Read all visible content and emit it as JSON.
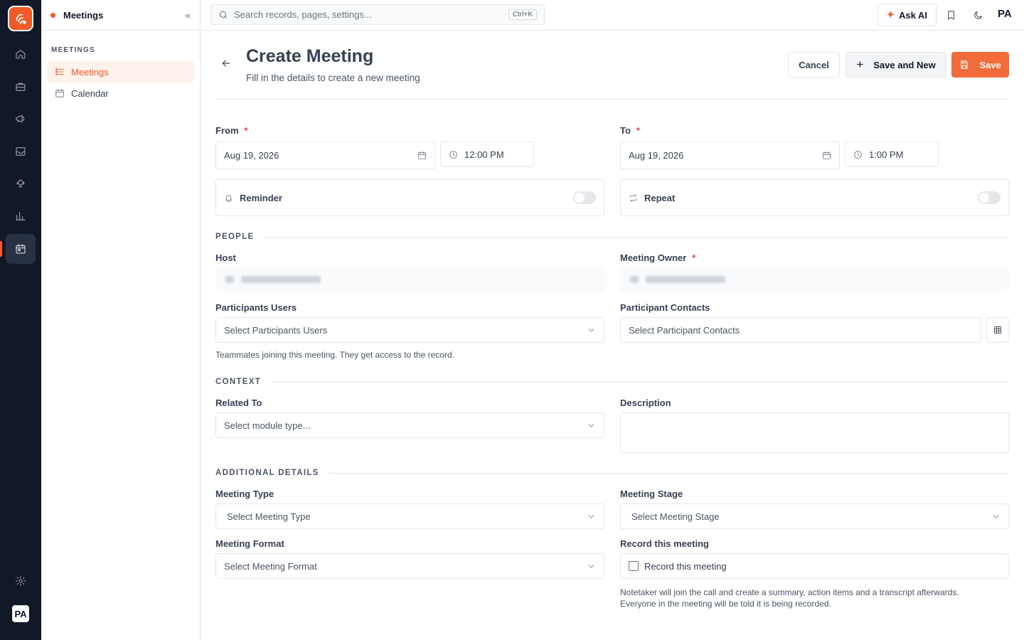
{
  "sidebar": {
    "title": "Meetings",
    "section": "MEETINGS",
    "items": [
      {
        "label": "Meetings"
      },
      {
        "label": "Calendar"
      }
    ],
    "avatar": "PA"
  },
  "topbar": {
    "search_placeholder": "Search records, pages, settings...",
    "shortcut": "Ctrl+K",
    "ask_ai": "Ask AI",
    "avatar": "PA"
  },
  "header": {
    "title": "Create Meeting",
    "subtitle": "Fill in the details to create a new meeting",
    "cancel": "Cancel",
    "save_new": "Save and New",
    "save": "Save"
  },
  "form": {
    "from": {
      "label": "From",
      "date": "Aug 19, 2026",
      "time": "12:00 PM"
    },
    "to": {
      "label": "To",
      "date": "Aug 19, 2026",
      "time": "1:00 PM"
    },
    "reminder": "Reminder",
    "repeat": "Repeat",
    "people_section": "PEOPLE",
    "host": "Host",
    "meeting_owner": "Meeting Owner",
    "participants_users": {
      "label": "Participants Users",
      "placeholder": "Select Participants Users",
      "help": "Teammates joining this meeting. They get access to the record."
    },
    "participant_contacts": {
      "label": "Participant Contacts",
      "placeholder": "Select Participant Contacts"
    },
    "context_section": "CONTEXT",
    "related_to": {
      "label": "Related To",
      "placeholder": "Select module type..."
    },
    "description": {
      "label": "Description"
    },
    "additional_section": "ADDITIONAL DETAILS",
    "meeting_type": {
      "label": "Meeting Type",
      "placeholder": "Select Meeting Type"
    },
    "meeting_stage": {
      "label": "Meeting Stage",
      "placeholder": "Select Meeting Stage"
    },
    "meeting_format": {
      "label": "Meeting Format",
      "placeholder": "Select Meeting Format"
    },
    "record": {
      "label": "Record this meeting",
      "checkbox": "Record this meeting",
      "help1": "Notetaker will join the call and create a summary, action items and a transcript afterwards.",
      "help2": "Everyone in the meeting will be told it is being recorded."
    },
    "required_mark": "*"
  },
  "colors": {
    "accent": "#f05a28",
    "rail": "#111827"
  }
}
